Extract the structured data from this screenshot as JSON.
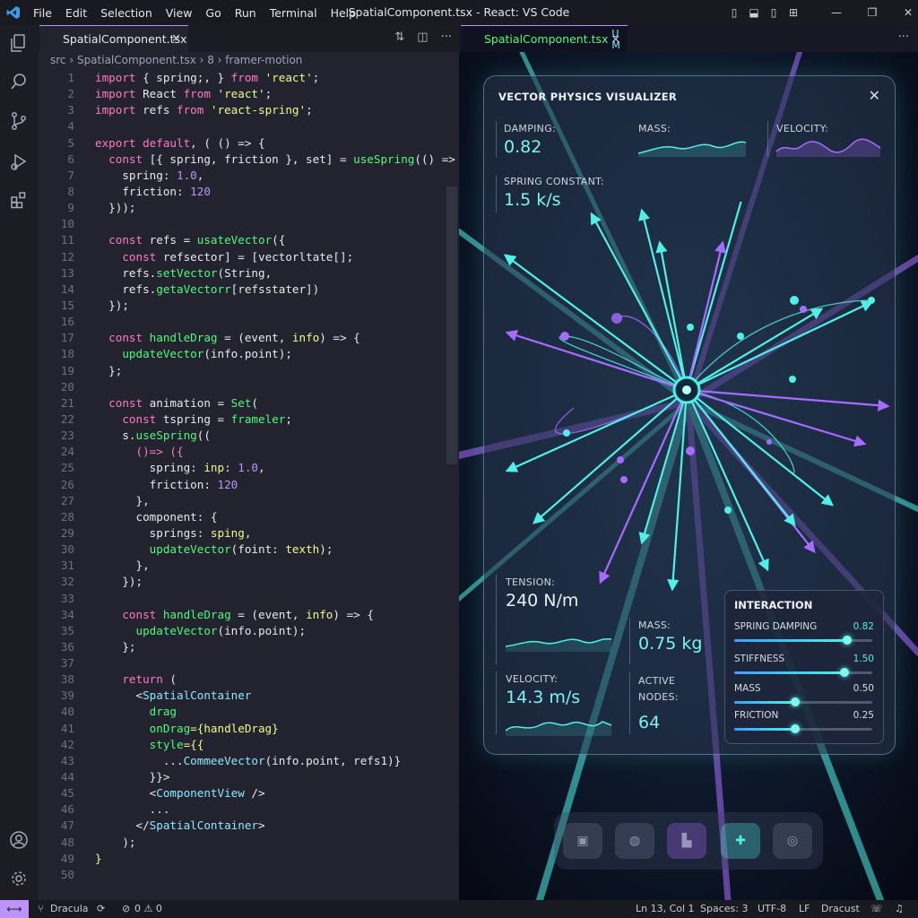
{
  "window": {
    "title": "SpatialComponent.tsx - React: VS Code",
    "menu": [
      "File",
      "Edit",
      "Selection",
      "View",
      "Go",
      "Run",
      "Terminal",
      "Help"
    ]
  },
  "editor": {
    "tab_label": "SpatialComponent.tsx",
    "breadcrumb": "src  ›  SpatialComponent.tsx  ›  8  ›  framer-motion",
    "lines": [
      [
        {
          "t": "import ",
          "c": "kw"
        },
        {
          "t": "{ spring;, } ",
          "c": "pl"
        },
        {
          "t": "from ",
          "c": "kw"
        },
        {
          "t": "'react'",
          "c": "st"
        },
        {
          "t": ";",
          "c": "pl"
        }
      ],
      [
        {
          "t": "import ",
          "c": "kw"
        },
        {
          "t": "React ",
          "c": "pl"
        },
        {
          "t": "from ",
          "c": "kw"
        },
        {
          "t": "'react'",
          "c": "st"
        },
        {
          "t": ";",
          "c": "pl"
        }
      ],
      [
        {
          "t": "import ",
          "c": "kw"
        },
        {
          "t": "refs ",
          "c": "pl"
        },
        {
          "t": "from ",
          "c": "kw"
        },
        {
          "t": "'react-spring'",
          "c": "st"
        },
        {
          "t": ";",
          "c": "pl"
        }
      ],
      [],
      [
        {
          "t": "export default",
          "c": "kw"
        },
        {
          "t": ", ( () => {",
          "c": "pl"
        }
      ],
      [
        {
          "t": "  const ",
          "c": "kw"
        },
        {
          "t": "[{ spring, friction }, set] = ",
          "c": "pl"
        },
        {
          "t": "useSpring",
          "c": "fn"
        },
        {
          "t": "(() => (",
          "c": "pl"
        }
      ],
      [
        {
          "t": "    spring: ",
          "c": "pl"
        },
        {
          "t": "1.0",
          "c": "nm"
        },
        {
          "t": ",",
          "c": "pl"
        }
      ],
      [
        {
          "t": "    friction: ",
          "c": "pl"
        },
        {
          "t": "120",
          "c": "nm"
        }
      ],
      [
        {
          "t": "  }));",
          "c": "pl"
        }
      ],
      [],
      [
        {
          "t": "  const ",
          "c": "kw"
        },
        {
          "t": "refs = ",
          "c": "pl"
        },
        {
          "t": "usateVector",
          "c": "fn"
        },
        {
          "t": "({",
          "c": "pl"
        }
      ],
      [
        {
          "t": "    const ",
          "c": "kw"
        },
        {
          "t": "refsector] = ",
          "c": "pl"
        },
        {
          "t": "[vectorltate[]",
          "c": "pl"
        },
        {
          "t": ";",
          "c": "pl"
        }
      ],
      [
        {
          "t": "    refs.",
          "c": "pl"
        },
        {
          "t": "setVector",
          "c": "fn"
        },
        {
          "t": "(String,",
          "c": "pl"
        }
      ],
      [
        {
          "t": "    refs.",
          "c": "pl"
        },
        {
          "t": "getaVectorr",
          "c": "fn"
        },
        {
          "t": "[refsstater])",
          "c": "pl"
        }
      ],
      [
        {
          "t": "  });",
          "c": "pl"
        }
      ],
      [],
      [
        {
          "t": "  const ",
          "c": "kw"
        },
        {
          "t": "handleDrag",
          "c": "fn"
        },
        {
          "t": " = (event, ",
          "c": "pl"
        },
        {
          "t": "info",
          "c": "st"
        },
        {
          "t": ") => {",
          "c": "pl"
        }
      ],
      [
        {
          "t": "    ",
          "c": "pl"
        },
        {
          "t": "updateVector",
          "c": "fn"
        },
        {
          "t": "(info.point);",
          "c": "pl"
        }
      ],
      [
        {
          "t": "  };",
          "c": "pl"
        }
      ],
      [],
      [
        {
          "t": "  const ",
          "c": "kw"
        },
        {
          "t": "animation = ",
          "c": "pl"
        },
        {
          "t": "Set",
          "c": "fn"
        },
        {
          "t": "(",
          "c": "pl"
        }
      ],
      [
        {
          "t": "    const ",
          "c": "kw"
        },
        {
          "t": "tspring = ",
          "c": "pl"
        },
        {
          "t": "frameler",
          "c": "fn"
        },
        {
          "t": ";",
          "c": "pl"
        }
      ],
      [
        {
          "t": "    s.",
          "c": "pl"
        },
        {
          "t": "useSpring",
          "c": "fn"
        },
        {
          "t": "((",
          "c": "pl"
        }
      ],
      [
        {
          "t": "      ()=> ({",
          "c": "kw"
        }
      ],
      [
        {
          "t": "        spring: ",
          "c": "pl"
        },
        {
          "t": "inp",
          "c": "st"
        },
        {
          "t": ": ",
          "c": "pl"
        },
        {
          "t": "1.0",
          "c": "nm"
        },
        {
          "t": ",",
          "c": "pl"
        }
      ],
      [
        {
          "t": "        friction: ",
          "c": "pl"
        },
        {
          "t": "120",
          "c": "nm"
        }
      ],
      [
        {
          "t": "      },",
          "c": "pl"
        }
      ],
      [
        {
          "t": "      component: {",
          "c": "pl"
        }
      ],
      [
        {
          "t": "        springs: ",
          "c": "pl"
        },
        {
          "t": "sping",
          "c": "st"
        },
        {
          "t": ",",
          "c": "pl"
        }
      ],
      [
        {
          "t": "        ",
          "c": "pl"
        },
        {
          "t": "updateVector",
          "c": "fn"
        },
        {
          "t": "(foint: ",
          "c": "pl"
        },
        {
          "t": "texth",
          "c": "st"
        },
        {
          "t": ");",
          "c": "pl"
        }
      ],
      [
        {
          "t": "      },",
          "c": "pl"
        }
      ],
      [
        {
          "t": "    });",
          "c": "pl"
        }
      ],
      [],
      [
        {
          "t": "    const ",
          "c": "kw"
        },
        {
          "t": "handleDrag",
          "c": "fn"
        },
        {
          "t": " = (event, ",
          "c": "pl"
        },
        {
          "t": "info",
          "c": "st"
        },
        {
          "t": ") => {",
          "c": "pl"
        }
      ],
      [
        {
          "t": "      ",
          "c": "pl"
        },
        {
          "t": "updateVector",
          "c": "fn"
        },
        {
          "t": "(info.point);",
          "c": "pl"
        }
      ],
      [
        {
          "t": "    };",
          "c": "pl"
        }
      ],
      [],
      [
        {
          "t": "    return ",
          "c": "kw"
        },
        {
          "t": "(",
          "c": "pl"
        }
      ],
      [
        {
          "t": "      <",
          "c": "pl"
        },
        {
          "t": "SpatialContainer",
          "c": "tg"
        }
      ],
      [
        {
          "t": "        drag",
          "c": "fn"
        }
      ],
      [
        {
          "t": "        onDrag",
          "c": "fn"
        },
        {
          "t": "={handleDrag}",
          "c": "st"
        }
      ],
      [
        {
          "t": "        style",
          "c": "fn"
        },
        {
          "t": "={{",
          "c": "st"
        }
      ],
      [
        {
          "t": "          ...",
          "c": "pl"
        },
        {
          "t": "CommeeVector",
          "c": "tg"
        },
        {
          "t": "(info.point, refs1)}",
          "c": "pl"
        }
      ],
      [
        {
          "t": "        }}>",
          "c": "pl"
        }
      ],
      [
        {
          "t": "        <",
          "c": "pl"
        },
        {
          "t": "ComponentView",
          "c": "tg"
        },
        {
          "t": " />",
          "c": "pl"
        }
      ],
      [
        {
          "t": "        ...",
          "c": "pl"
        }
      ],
      [
        {
          "t": "      </",
          "c": "pl"
        },
        {
          "t": "SpatialContainer",
          "c": "tg"
        },
        {
          "t": ">",
          "c": "pl"
        }
      ],
      [
        {
          "t": "    );",
          "c": "pl"
        }
      ],
      [
        {
          "t": "}",
          "c": "st"
        }
      ],
      []
    ]
  },
  "preview": {
    "tab_label": "SpatialComponent.tsx",
    "tab_badge": "U M",
    "panel": {
      "title": "VECTOR PHYSICS VISUALIZER",
      "damping_label": "DAMPING:",
      "damping_value": "0.82",
      "mass_top_label": "MASS:",
      "velocity_top_label": "VELOCITY:",
      "spring_label": "SPRING CONSTANT:",
      "spring_value": "1.5 k/s",
      "tension_label": "TENSION:",
      "tension_value": "240 N/m",
      "mass_label": "MASS:",
      "mass_value": "0.75 kg",
      "velocity_label": "VELOCITY:",
      "velocity_value": "14.3 m/s",
      "active_label": "ACTIVE NODES:",
      "active_value": "64"
    },
    "interaction": {
      "title": "INTERACTION",
      "sliders": [
        {
          "name": "SPRING DAMPING",
          "value": "0.82",
          "level": 0.82
        },
        {
          "name": "STIFFNESS",
          "value": "1.50",
          "level": 0.8
        },
        {
          "name": "MASS",
          "value": "0.50",
          "level": 0.44
        },
        {
          "name": "FRICTION",
          "value": "0.25",
          "level": 0.44
        }
      ]
    }
  },
  "statusbar": {
    "theme": "Dracula",
    "problems": "0 ⚠ 0",
    "position": "Ln 13, Col 1",
    "spaces": "Spaces: 3",
    "encoding": "UTF-8",
    "eol": "LF",
    "language": "Dracust"
  },
  "colors": {
    "accent": "#bd93f9",
    "cyan": "#4ff0e6",
    "purple": "#a86bff"
  }
}
